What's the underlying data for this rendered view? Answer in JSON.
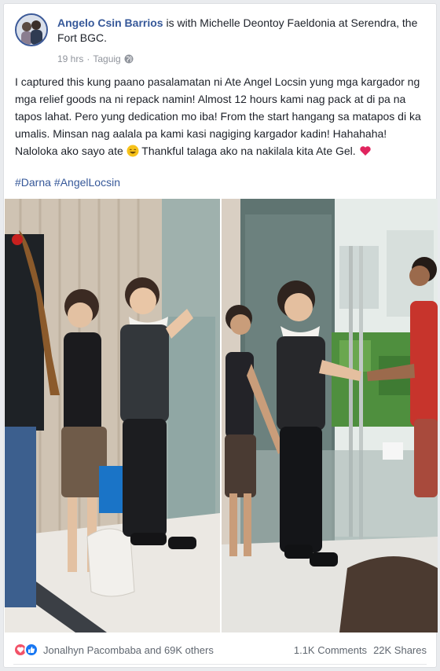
{
  "post": {
    "author": "Angelo Csin Barrios",
    "with_text": " is with ",
    "tagged": "Michelle Deontoy Faeldonia",
    "at_text": " at ",
    "location": "Serendra, the Fort BGC",
    "location_suffix": ".",
    "time": "19 hrs",
    "separator": "·",
    "place": "Taguig",
    "body_1": "I captured this kung paano pasalamatan ni Ate Angel Locsin yung mga kargador ng mga relief goods na ni repack namin! Almost 12 hours kami nag pack at di pa na tapos lahat. Pero yung dedication mo iba! From the start hangang sa matapos di ka umalis. Minsan nag aalala pa kami kasi nagiging kargador kadin! Hahahaha! Naloloka ako sayo ate ",
    "body_2": " Thankful talaga ako na nakilala kita Ate Gel. ",
    "hashtags": [
      "#Darna",
      "#AngelLocsin"
    ]
  },
  "footer": {
    "reactors": "Jonalhyn Pacombaba and 69K others",
    "comments": "1.1K Comments",
    "shares": "22K Shares"
  },
  "colors": {
    "link": "#365899",
    "text": "#1d2129",
    "meta": "#90949c",
    "love": "#f25268",
    "like": "#1877f2"
  },
  "icons": [
    "globe-icon",
    "smile-emoji-icon",
    "heart-emoji-icon",
    "love-reaction-icon",
    "like-reaction-icon"
  ]
}
